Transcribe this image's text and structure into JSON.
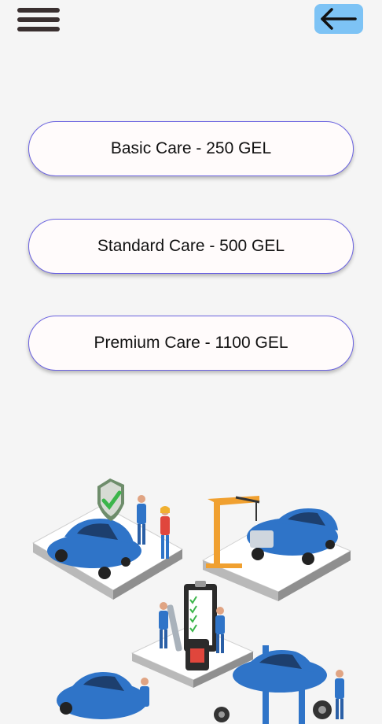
{
  "header": {
    "menu_icon": "hamburger-menu-icon",
    "back_icon": "arrow-left-icon",
    "back_button_color": "#7dc3f5"
  },
  "plans": [
    {
      "label": "Basic Care - 250 GEL"
    },
    {
      "label": "Standard Care - 500 GEL"
    },
    {
      "label": "Premium Care - 1100 GEL"
    }
  ],
  "colors": {
    "button_border": "#6b63e0",
    "button_fill": "#fffbfb",
    "car_blue": "#2f74c8"
  }
}
